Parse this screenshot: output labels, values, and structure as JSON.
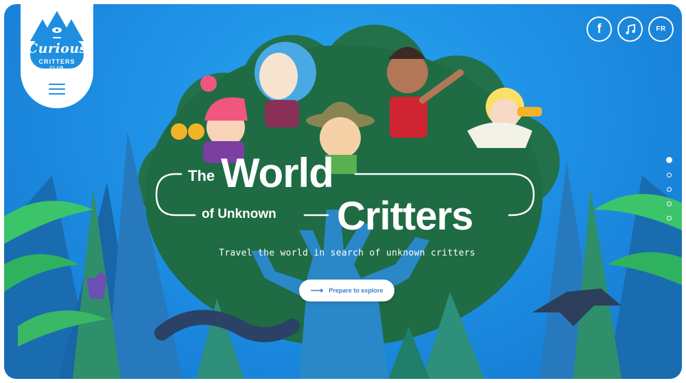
{
  "logo": {
    "line1": "Curious",
    "line2": "CRITTERS",
    "line3": "CLUB"
  },
  "menu": {
    "icon": "hamburger-menu-icon"
  },
  "social": {
    "facebook_label": "f",
    "music_icon": "music-note-icon",
    "language_label": "FR"
  },
  "hero": {
    "title_the": "The",
    "title_world": "World",
    "title_of_unknown": "of Unknown",
    "title_critters": "Critters",
    "subtitle": "Travel the world in search of unknown critters",
    "cta_label": "Prepare to explore",
    "cta_icon": "arrow-right-icon"
  },
  "pagination": {
    "count": 5,
    "active_index": 0
  },
  "colors": {
    "sky": "#1e90e5",
    "tree": "#1f6b44",
    "accent": "#3a7fd0",
    "white": "#ffffff"
  }
}
